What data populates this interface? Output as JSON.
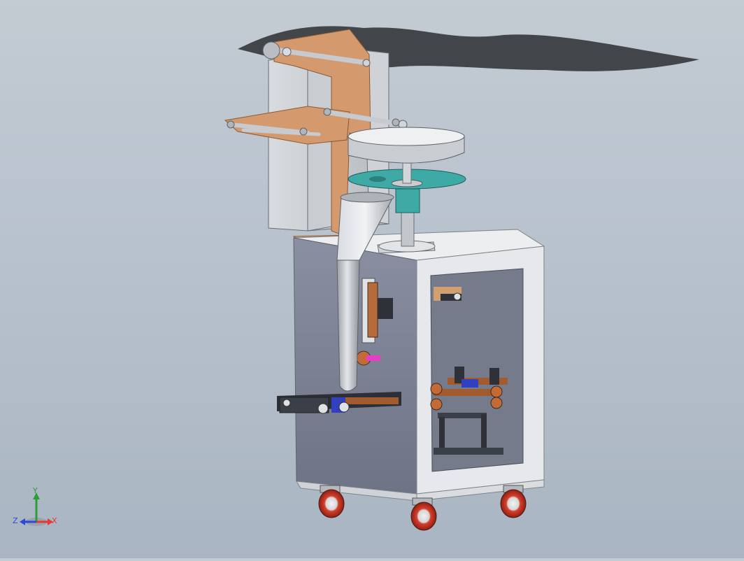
{
  "triad": {
    "x_label": "X",
    "y_label": "Y",
    "z_label": "Z",
    "x_color": "#e53935",
    "y_color": "#2e9c3c",
    "z_color": "#2f49d6"
  },
  "colors": {
    "frame_light": "#e9ecef",
    "frame_panel": "#7d8294",
    "bracket_copper": "#d49a6e",
    "turntable_teal": "#3fa9a5",
    "hopper_gray": "#c9cdd2",
    "wheel_red": "#c9301f"
  }
}
